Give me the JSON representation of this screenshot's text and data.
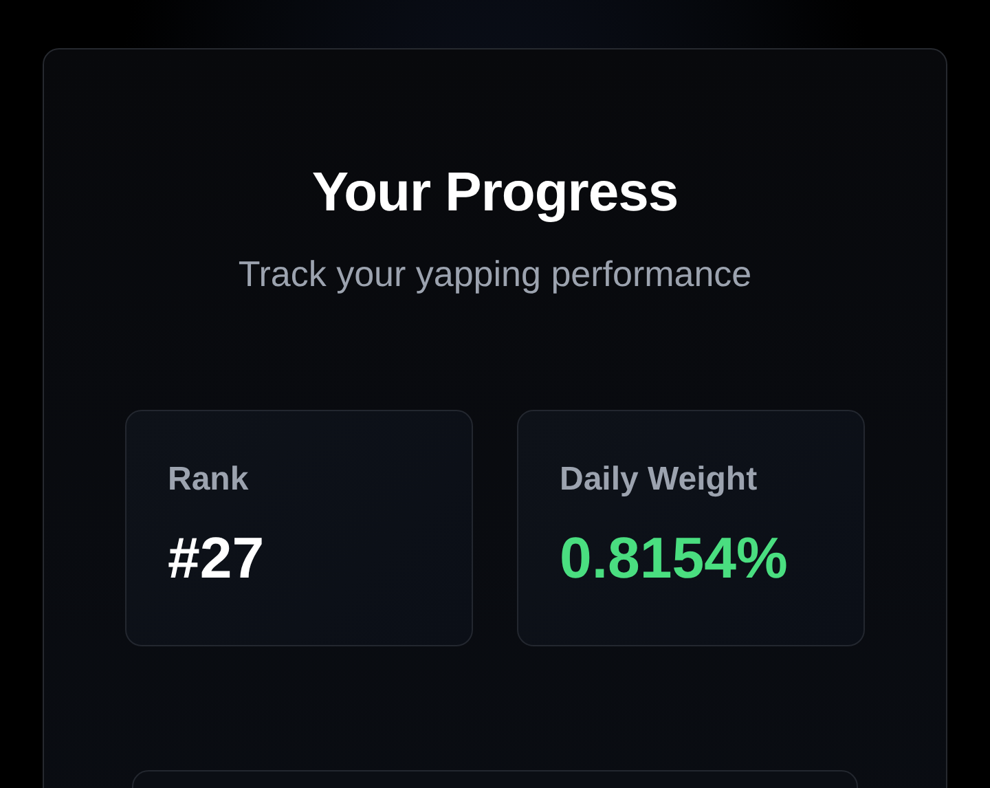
{
  "title": "Your Progress",
  "subtitle": "Track your yapping performance",
  "stats": [
    {
      "label": "Rank",
      "value": "#27",
      "color": "#ffffff"
    },
    {
      "label": "Daily Weight",
      "value": "0.8154%",
      "color": "#4ade80"
    }
  ]
}
